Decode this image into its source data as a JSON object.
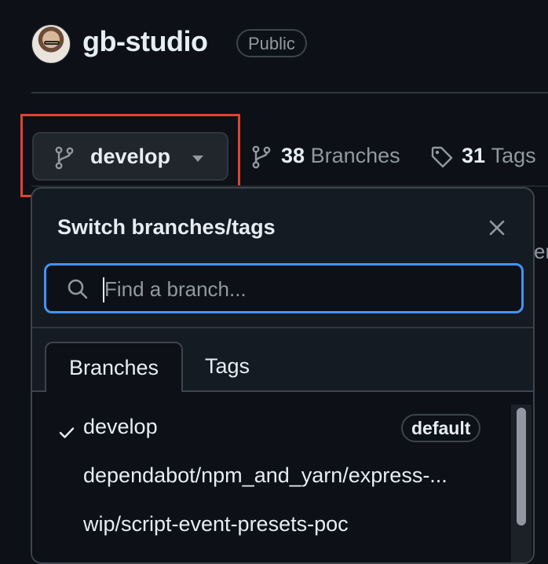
{
  "repo": {
    "name": "gb-studio",
    "visibility": "Public"
  },
  "branch_selector": {
    "current": "develop",
    "icon": "git-branch-icon",
    "caret": "triangle-down-icon"
  },
  "stats": {
    "branches_count": "38",
    "branches_label": "Branches",
    "tags_count": "31",
    "tags_label": "Tags"
  },
  "background_text": "er",
  "dropdown": {
    "title": "Switch branches/tags",
    "search_placeholder": "Find a branch...",
    "tabs": [
      {
        "label": "Branches",
        "selected": true
      },
      {
        "label": "Tags",
        "selected": false
      }
    ],
    "branches": [
      {
        "name": "develop",
        "checked": true,
        "badge": "default"
      },
      {
        "name": "dependabot/npm_and_yarn/express-...",
        "checked": false
      },
      {
        "name": "wip/script-event-presets-poc",
        "checked": false
      }
    ]
  },
  "colors": {
    "background": "#0d1117",
    "accent_focus": "#4493f8",
    "highlight_box": "#e0432f"
  }
}
